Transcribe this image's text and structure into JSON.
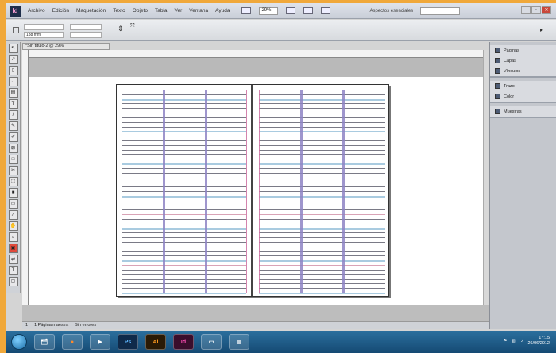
{
  "app": {
    "logo": "Id",
    "menu": [
      "Archivo",
      "Edición",
      "Maquetación",
      "Texto",
      "Objeto",
      "Tabla",
      "Ver",
      "Ventana",
      "Ayuda"
    ],
    "zoom": "29%",
    "workspace": "Aspectos esenciales",
    "window_controls": [
      "–",
      "▫",
      "✕"
    ]
  },
  "control_bar": {
    "x_value": "",
    "y_value": "188 mm"
  },
  "document": {
    "tab_title": "*Sin título-2 @ 29%",
    "spread": {
      "columns_per_page": 3,
      "row_lines": 44
    }
  },
  "status": {
    "page": "1",
    "page_label": "1 Página maestra",
    "preflight": "Sin errores"
  },
  "panels": {
    "group1": [
      {
        "icon": "pages-icon",
        "label": "Páginas"
      },
      {
        "icon": "layers-icon",
        "label": "Capas"
      },
      {
        "icon": "links-icon",
        "label": "Vínculos"
      }
    ],
    "group2": [
      {
        "icon": "stroke-icon",
        "label": "Trazo"
      },
      {
        "icon": "color-icon",
        "label": "Color"
      }
    ],
    "group3": [
      {
        "icon": "swatches-icon",
        "label": "Muestras"
      }
    ]
  },
  "taskbar": {
    "apps": [
      {
        "name": "explorer",
        "label": "🗂"
      },
      {
        "name": "firefox",
        "label": "●"
      },
      {
        "name": "media",
        "label": "▶"
      },
      {
        "name": "photoshop",
        "label": "Ps"
      },
      {
        "name": "illustrator",
        "label": "Ai"
      },
      {
        "name": "indesign",
        "label": "Id"
      },
      {
        "name": "explorer-2",
        "label": "▭"
      },
      {
        "name": "window",
        "label": "▤"
      }
    ],
    "clock_time": "17:15",
    "clock_date": "26/06/2012"
  }
}
